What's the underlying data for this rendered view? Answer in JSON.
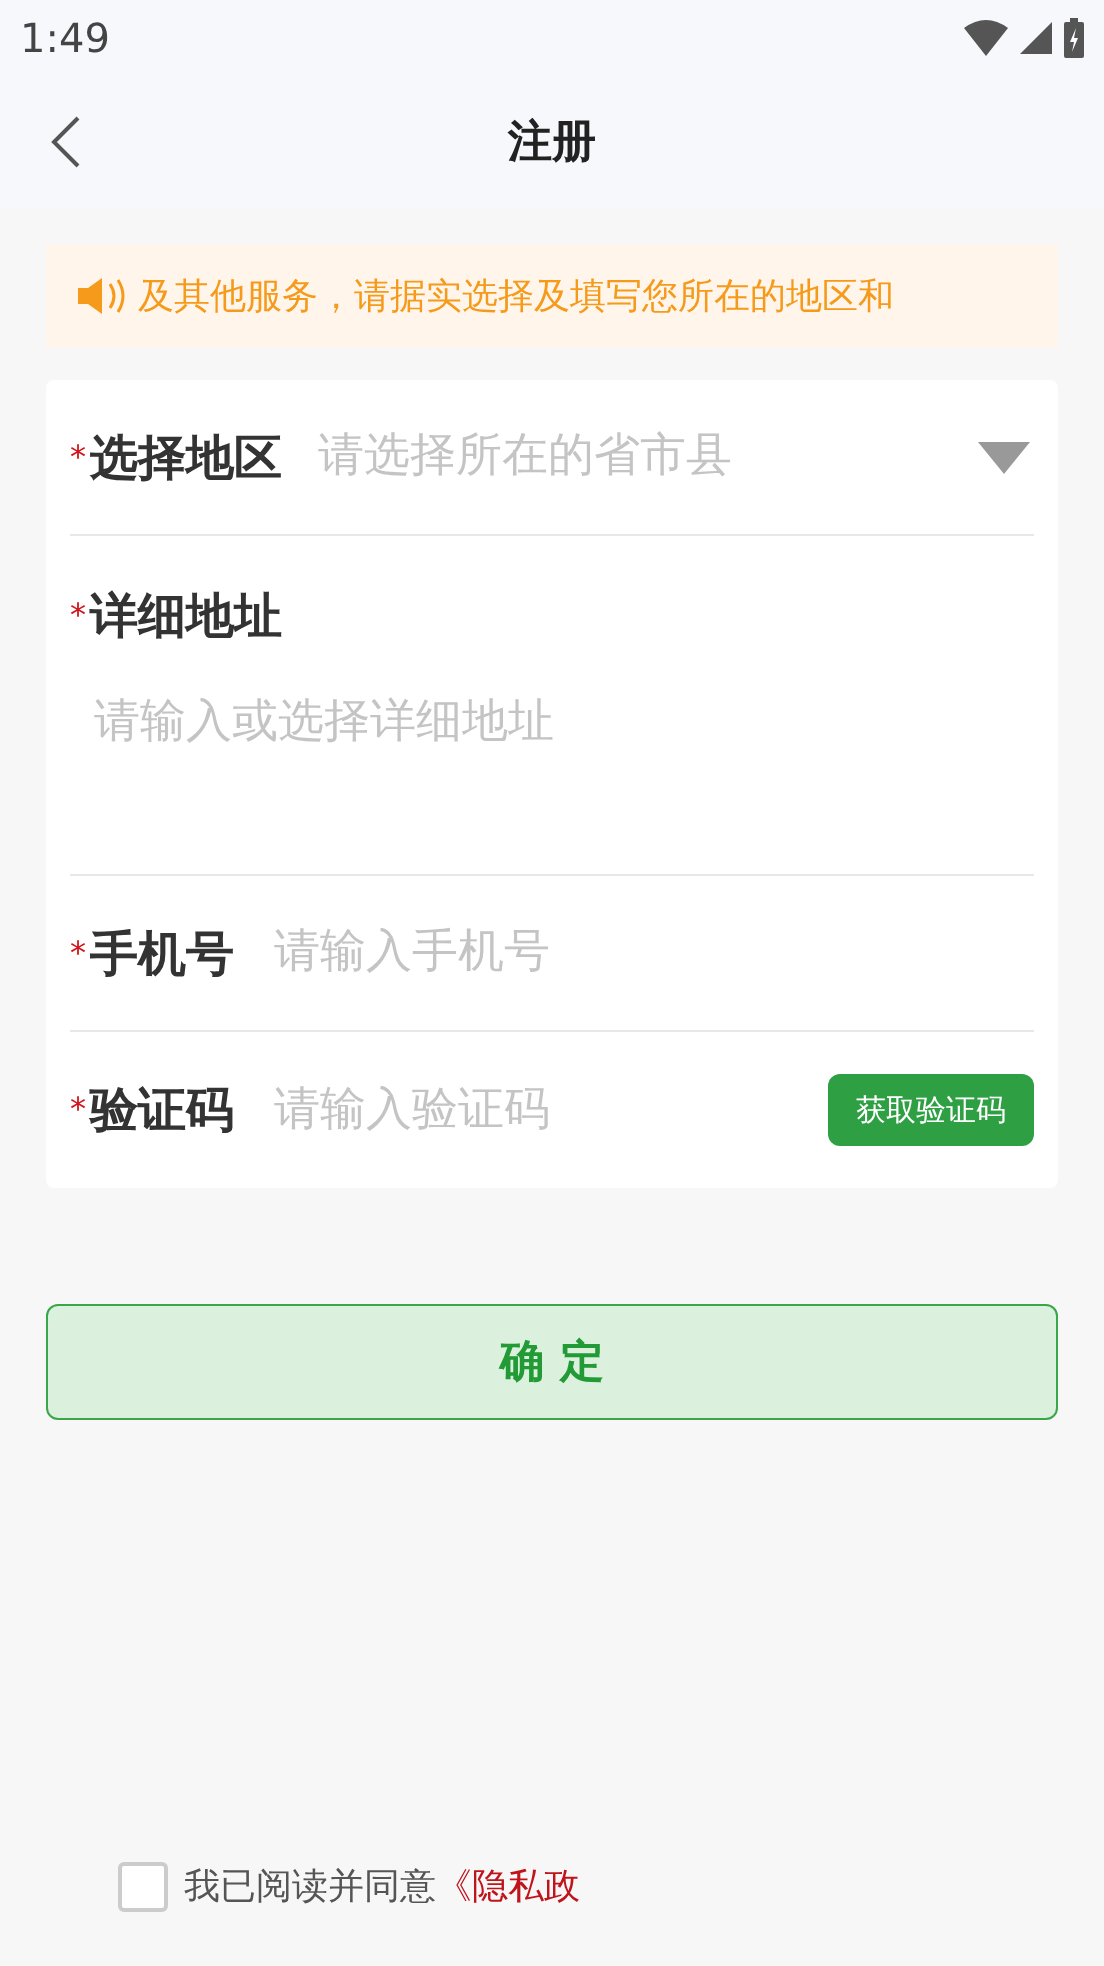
{
  "status_bar": {
    "time": "1:49"
  },
  "header": {
    "title": "注册"
  },
  "notice": {
    "text": "及其他服务，请据实选择及填写您所在的地区和"
  },
  "form": [
    {
      "kind": "select",
      "label": "选择地区",
      "required_mark": "*",
      "placeholder": "请选择所在的省市县"
    },
    {
      "kind": "textarea",
      "label": "详细地址",
      "required_mark": "*",
      "placeholder": "请输入或选择详细地址"
    },
    {
      "kind": "text",
      "label": "手机号",
      "required_mark": "*",
      "placeholder": "请输入手机号"
    },
    {
      "kind": "code",
      "label": "验证码",
      "required_mark": "*",
      "placeholder": "请输入验证码",
      "button": "获取验证码"
    }
  ],
  "submit": {
    "label": "确 定"
  },
  "agreement": {
    "checked": false,
    "text": "我已阅读并同意",
    "link": "《隐私政"
  }
}
